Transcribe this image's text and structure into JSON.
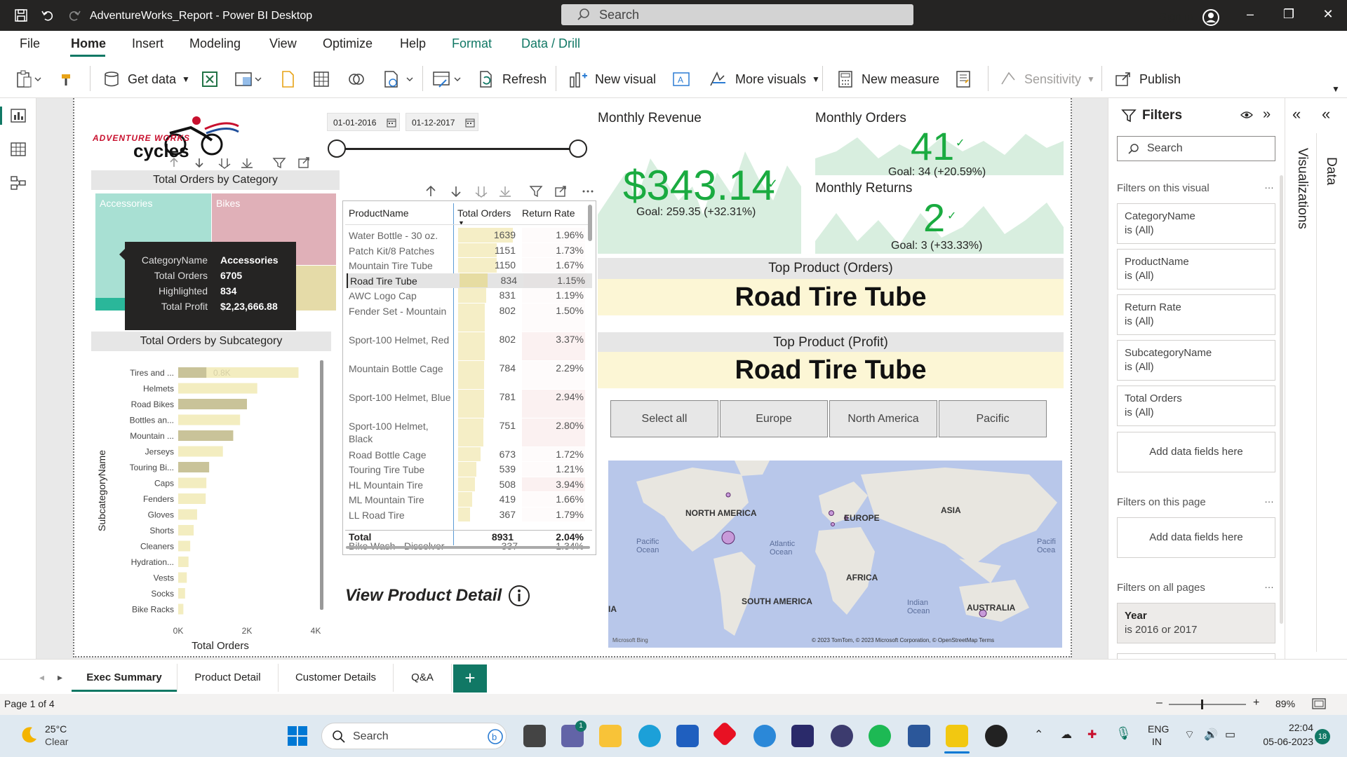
{
  "window": {
    "title": "AdventureWorks_Report - Power BI Desktop",
    "search_placeholder": "Search",
    "sign_in": "Sign in"
  },
  "menu": [
    "File",
    "Home",
    "Insert",
    "Modeling",
    "View",
    "Optimize",
    "Help",
    "Format",
    "Data / Drill"
  ],
  "ribbon": {
    "get_data": "Get data",
    "refresh": "Refresh",
    "new_visual": "New visual",
    "more_visuals": "More visuals",
    "new_measure": "New measure",
    "sensitivity": "Sensitivity",
    "publish": "Publish"
  },
  "slicer": {
    "start": "01-01-2016",
    "end": "01-12-2017"
  },
  "logo": {
    "line1": "ADVENTURE WORKS",
    "line2": "cycles"
  },
  "treemap": {
    "title": "Total Orders by Category",
    "labels": [
      "Accessories",
      "Bikes"
    ],
    "tooltip": {
      "rows": [
        {
          "k": "CategoryName",
          "v": "Accessories"
        },
        {
          "k": "Total Orders",
          "v": "6705"
        },
        {
          "k": "Highlighted",
          "v": "834"
        },
        {
          "k": "Total Profit",
          "v": "$2,23,666.88"
        }
      ]
    }
  },
  "subcat_chart": {
    "title": "Total Orders by Subcategory",
    "ylabel": "SubcategoryName",
    "xlabel": "Total Orders",
    "ticks": [
      "0K",
      "2K",
      "4K"
    ],
    "data_label": "0.8K",
    "categories": [
      "Tires and ...",
      "Helmets",
      "Road Bikes",
      "Bottles an...",
      "Mountain ...",
      "Jerseys",
      "Touring Bi...",
      "Caps",
      "Fenders",
      "Gloves",
      "Shorts",
      "Cleaners",
      "Hydration...",
      "Vests",
      "Socks",
      "Bike Racks"
    ],
    "values": [
      3.5,
      2.3,
      2.0,
      1.8,
      1.6,
      1.3,
      0.9,
      0.82,
      0.8,
      0.55,
      0.45,
      0.35,
      0.3,
      0.25,
      0.2,
      0.15
    ],
    "highlight": [
      0.82,
      0,
      2.0,
      0,
      1.6,
      0,
      0.9,
      0,
      0,
      0,
      0,
      0,
      0,
      0,
      0,
      0
    ]
  },
  "table": {
    "headers": [
      "ProductName",
      "Total Orders",
      "Return Rate"
    ],
    "rows": [
      {
        "name": "Water Bottle - 30 oz.",
        "orders": "1639",
        "rate": "1.96%",
        "lines": 1
      },
      {
        "name": "Patch Kit/8 Patches",
        "orders": "1151",
        "rate": "1.73%",
        "lines": 1
      },
      {
        "name": "Mountain Tire Tube",
        "orders": "1150",
        "rate": "1.67%",
        "lines": 1
      },
      {
        "name": "Road Tire Tube",
        "orders": "834",
        "rate": "1.15%",
        "lines": 1
      },
      {
        "name": "AWC Logo Cap",
        "orders": "831",
        "rate": "1.19%",
        "lines": 1
      },
      {
        "name": "Fender Set - Mountain",
        "orders": "802",
        "rate": "1.50%",
        "lines": 2
      },
      {
        "name": "Sport-100 Helmet, Red",
        "orders": "802",
        "rate": "3.37%",
        "lines": 2
      },
      {
        "name": "Mountain Bottle Cage",
        "orders": "784",
        "rate": "2.29%",
        "lines": 2
      },
      {
        "name": "Sport-100 Helmet, Blue",
        "orders": "781",
        "rate": "2.94%",
        "lines": 2
      },
      {
        "name": "Sport-100 Helmet, Black",
        "orders": "751",
        "rate": "2.80%",
        "lines": 2
      },
      {
        "name": "Road Bottle Cage",
        "orders": "673",
        "rate": "1.72%",
        "lines": 1
      },
      {
        "name": "Touring Tire Tube",
        "orders": "539",
        "rate": "1.21%",
        "lines": 1
      },
      {
        "name": "HL Mountain Tire",
        "orders": "508",
        "rate": "3.94%",
        "lines": 1
      },
      {
        "name": "ML Mountain Tire",
        "orders": "419",
        "rate": "1.66%",
        "lines": 1
      },
      {
        "name": "LL Road Tire",
        "orders": "367",
        "rate": "1.79%",
        "lines": 1
      }
    ],
    "total": {
      "label": "Total",
      "orders": "8931",
      "rate": "2.04%"
    },
    "partial_row": {
      "name": "Bike Wash - Dissolver",
      "orders": "337",
      "rate": "1.34%"
    }
  },
  "view_detail": "View Product Detail",
  "kpis": {
    "revenue": {
      "title": "Monthly Revenue",
      "value": "$343.14",
      "goal": "Goal: 259.35 (+32.31%)"
    },
    "orders": {
      "title": "Monthly Orders",
      "value": "41",
      "goal": "Goal: 34 (+20.59%)"
    },
    "returns": {
      "title": "Monthly Returns",
      "value": "2",
      "goal": "Goal: 3 (+33.33%)"
    }
  },
  "cards": {
    "top_orders": {
      "title": "Top Product (Orders)",
      "value": "Road Tire Tube"
    },
    "top_profit": {
      "title": "Top Product (Profit)",
      "value": "Road Tire Tube"
    }
  },
  "region_buttons": [
    "Select all",
    "Europe",
    "North America",
    "Pacific"
  ],
  "map": {
    "labels": [
      "NORTH AMERICA",
      "EUROPE",
      "ASIA",
      "AFRICA",
      "SOUTH AMERICA",
      "AUSTRALIA",
      "IA"
    ],
    "oceans": [
      "Pacific Ocean",
      "Atlantic Ocean",
      "Indian Ocean",
      "Pacifi Ocea"
    ],
    "attribution": "© 2023 TomTom, © 2023 Microsoft Corporation, © OpenStreetMap  Terms",
    "brand": "Microsoft Bing"
  },
  "filters": {
    "title": "Filters",
    "search": "Search",
    "on_visual": "Filters on this visual",
    "visual_filters": [
      {
        "field": "CategoryName",
        "state": "is (All)"
      },
      {
        "field": "ProductName",
        "state": "is (All)"
      },
      {
        "field": "Return Rate",
        "state": "is (All)"
      },
      {
        "field": "SubcategoryName",
        "state": "is (All)"
      },
      {
        "field": "Total Orders",
        "state": "is (All)"
      }
    ],
    "add_fields": "Add data fields here",
    "on_page": "Filters on this page",
    "on_all": "Filters on all pages",
    "year": {
      "field": "Year",
      "state": "is 2016 or 2017"
    }
  },
  "side_tabs": {
    "viz": "Visualizations",
    "data": "Data"
  },
  "tabs": [
    "Exec Summary",
    "Product Detail",
    "Customer Details",
    "Q&A"
  ],
  "status": {
    "page": "Page 1 of 4",
    "zoom": "89%"
  },
  "taskbar": {
    "weather_temp": "25°C",
    "weather_text": "Clear",
    "search": "Search",
    "lang1": "ENG",
    "lang2": "IN",
    "time": "22:04",
    "date": "05-06-2023",
    "badge": "18",
    "chat_badge": "1"
  },
  "colors": {
    "accent": "#117865",
    "kpi_green": "#1aab40",
    "bar": "#f3edc0",
    "bar_highlight": "#c9c399",
    "accessories": "#a8e0d3",
    "bikes": "#e0b0b8"
  }
}
